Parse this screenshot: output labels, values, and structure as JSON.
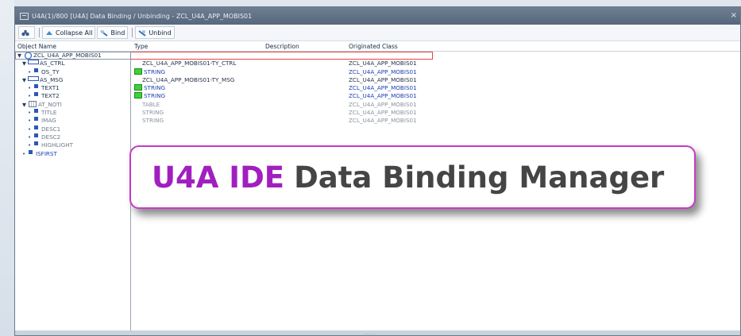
{
  "window": {
    "title": "U4A(1)/800 [U4A] Data Binding / Unbinding - ZCL_U4A_APP_MOBIS01",
    "close": "×"
  },
  "toolbar": {
    "collapse_label": "Collapse All",
    "bind_label": "Bind",
    "unbind_label": "Unbind"
  },
  "columns": {
    "object_name": "Object Name",
    "type": "Type",
    "description": "Description",
    "originated_class": "Originated Class"
  },
  "rows": [
    {
      "name": "ZCL_U4A_APP_MOBIS01",
      "type": "",
      "desc": "",
      "class": ""
    },
    {
      "name": "AS_CTRL",
      "type": "ZCL_U4A_APP_MOBIS01-TY_CTRL",
      "desc": "",
      "class": "ZCL_U4A_APP_MOBIS01"
    },
    {
      "name": "OS_TY",
      "type": "STRING",
      "desc": "",
      "class": "ZCL_U4A_APP_MOBIS01"
    },
    {
      "name": "AS_MSG",
      "type": "ZCL_U4A_APP_MOBIS01-TY_MSG",
      "desc": "",
      "class": "ZCL_U4A_APP_MOBIS01"
    },
    {
      "name": "TEXT1",
      "type": "STRING",
      "desc": "",
      "class": "ZCL_U4A_APP_MOBIS01"
    },
    {
      "name": "TEXT2",
      "type": "STRING",
      "desc": "",
      "class": "ZCL_U4A_APP_MOBIS01"
    },
    {
      "name": "AT_NOTI",
      "type": "TABLE",
      "desc": "",
      "class": "ZCL_U4A_APP_MOBIS01"
    },
    {
      "name": "TITLE",
      "type": "STRING",
      "desc": "",
      "class": "ZCL_U4A_APP_MOBIS01"
    },
    {
      "name": "IMAG",
      "type": "STRING",
      "desc": "",
      "class": "ZCL_U4A_APP_MOBIS01"
    },
    {
      "name": "DESC1",
      "type": "",
      "desc": "",
      "class": ""
    },
    {
      "name": "DESC2",
      "type": "",
      "desc": "",
      "class": ""
    },
    {
      "name": "HIGHLIGHT",
      "type": "",
      "desc": "",
      "class": ""
    },
    {
      "name": "ISFIRST",
      "type": "",
      "desc": "",
      "class": ""
    }
  ],
  "banner": {
    "part1": "U4A IDE",
    "part2": "Data Binding Manager"
  },
  "statusbar": {
    "grip": "....."
  },
  "colors": {
    "binding_green": "#3bd23b",
    "type_blue": "#1d3fb0",
    "banner_magenta": "#a11fbf",
    "selection_red": "#e24747"
  }
}
